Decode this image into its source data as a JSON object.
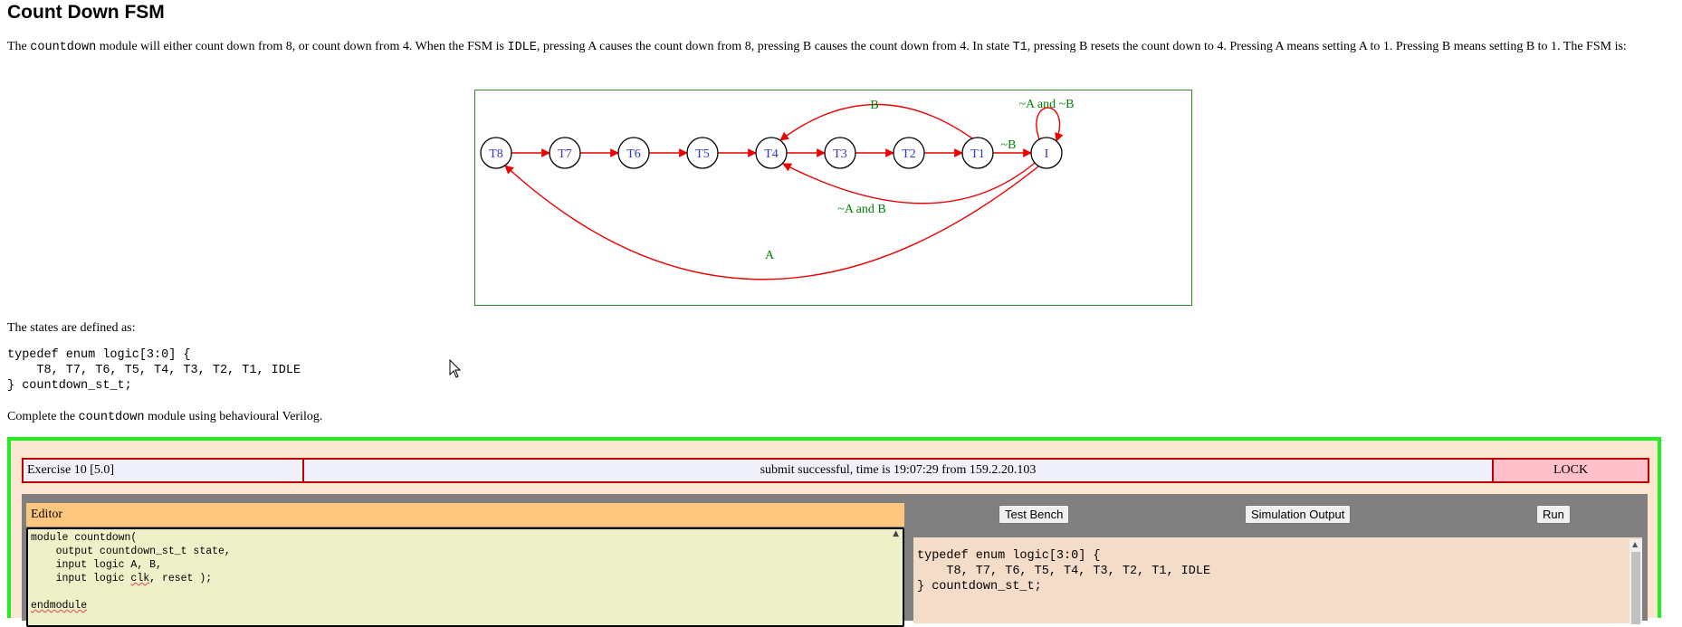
{
  "page": {
    "title": "Count Down FSM",
    "intro": {
      "t1": "The ",
      "c1": "countdown",
      "t2": " module will either count down from 8, or count down from 4. When the FSM is ",
      "c2": "IDLE",
      "t3": ", pressing A causes the count down from 8, pressing B causes the count down from 4. In state ",
      "c3": "T1",
      "t4": ", pressing B resets the count down to 4. Pressing A means setting A to 1. Pressing B means setting B to 1. The FSM is:"
    },
    "states_intro": "The states are defined as:",
    "states_code": "typedef enum logic[3:0] {\n    T8, T7, T6, T5, T4, T3, T2, T1, IDLE\n} countdown_st_t;",
    "complete": {
      "t1": "Complete the ",
      "c1": "countdown",
      "t2": " module using behavioural Verilog."
    }
  },
  "diagram": {
    "states": [
      {
        "id": "T8",
        "label": "T8"
      },
      {
        "id": "T7",
        "label": "T7"
      },
      {
        "id": "T6",
        "label": "T6"
      },
      {
        "id": "T5",
        "label": "T5"
      },
      {
        "id": "T4",
        "label": "T4"
      },
      {
        "id": "T3",
        "label": "T3"
      },
      {
        "id": "T2",
        "label": "T2"
      },
      {
        "id": "T1",
        "label": "T1"
      },
      {
        "id": "I",
        "label": "I"
      }
    ],
    "transitions": [
      {
        "from": "T8",
        "to": "T7",
        "label": ""
      },
      {
        "from": "T7",
        "to": "T6",
        "label": ""
      },
      {
        "from": "T6",
        "to": "T5",
        "label": ""
      },
      {
        "from": "T5",
        "to": "T4",
        "label": ""
      },
      {
        "from": "T4",
        "to": "T3",
        "label": ""
      },
      {
        "from": "T3",
        "to": "T2",
        "label": ""
      },
      {
        "from": "T2",
        "to": "T1",
        "label": ""
      },
      {
        "from": "T1",
        "to": "I",
        "label": "~B"
      },
      {
        "from": "T1",
        "to": "T4",
        "label": "B"
      },
      {
        "from": "I",
        "to": "I",
        "label": "~A and ~B"
      },
      {
        "from": "I",
        "to": "T4",
        "label": "~A and B"
      },
      {
        "from": "I",
        "to": "T8",
        "label": "A"
      }
    ],
    "colors": {
      "edge": "#ee0000",
      "edge_label": "#008000",
      "state_label": "#3333cc",
      "border": "#2e8b2e"
    }
  },
  "exercise": {
    "name": "Exercise 10 [5.0]",
    "status": "submit successful, time is 19:07:29 from 159.2.20.103",
    "lock_label": "LOCK",
    "editor_label": "Editor",
    "editor_lines": [
      "module countdown(",
      "    output countdown_st_t state,",
      "    input logic A, B,",
      "    input logic ",
      "clk",
      ", reset );",
      "",
      "endmodule"
    ],
    "buttons": {
      "test_bench": "Test Bench",
      "sim_output": "Simulation Output",
      "run": "Run"
    },
    "output_text": "typedef enum logic[3:0] {\n    T8, T7, T6, T5, T4, T3, T2, T1, IDLE\n} countdown_st_t;",
    "colors": {
      "frame": "#22ee22",
      "status_border": "#c00000",
      "lock_bg": "#ffc0cb",
      "editor_header": "#ffc680",
      "editor_bg": "#eef0c8",
      "output_bg": "#f3dcc8"
    }
  }
}
